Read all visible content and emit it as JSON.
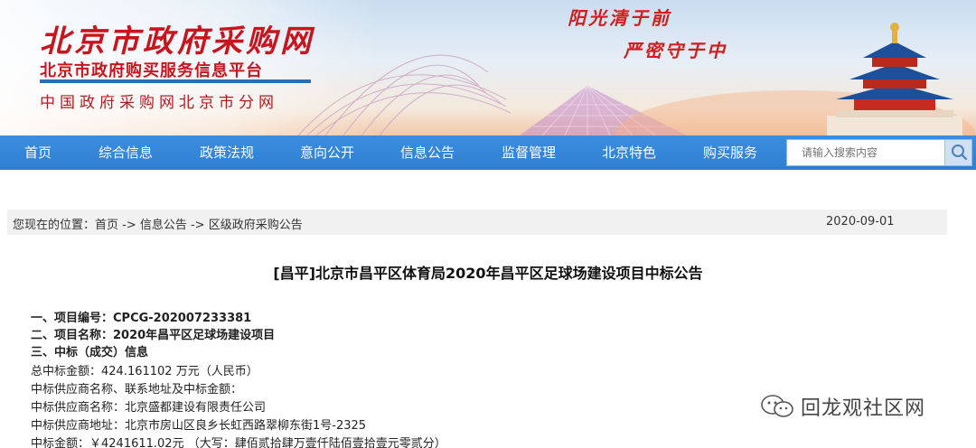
{
  "header": {
    "title": "北京市政府采购网",
    "subtitle": "北京市政府购买服务信息平台",
    "subtitle2": "中国政府采购网北京市分网",
    "slogan1": "阳光清于前",
    "slogan2": "严密守于中"
  },
  "nav": {
    "items": [
      {
        "label": "首页"
      },
      {
        "label": "综合信息"
      },
      {
        "label": "政策法规"
      },
      {
        "label": "意向公开"
      },
      {
        "label": "信息公告"
      },
      {
        "label": "监督管理"
      },
      {
        "label": "北京特色"
      },
      {
        "label": "购买服务"
      }
    ],
    "search_placeholder": "请输入搜索内容"
  },
  "breadcrumb": {
    "text": "您现在的位置：首页 -> 信息公告 -> 区级政府采购公告",
    "date": "2020-09-01"
  },
  "article": {
    "title": "[昌平]北京市昌平区体育局2020年昌平区足球场建设项目中标公告",
    "lines": [
      "一、项目编号：CPCG-202007233381",
      "二、项目名称：2020年昌平区足球场建设项目",
      "三、中标（成交）信息",
      "总中标金额：424.161102 万元（人民币）",
      "中标供应商名称、联系地址及中标金额：",
      "中标供应商名称：北京盛都建设有限责任公司",
      "中标供应商地址：北京市房山区良乡长虹西路翠柳东街1号-2325",
      "中标金额：￥4241611.02元 （大写：肆佰贰拾肆万壹仟陆佰壹拾壹元零贰分）"
    ]
  },
  "watermark": {
    "text": "回龙观社区网",
    "icon": "wechat-icon"
  },
  "colors": {
    "nav_bg": "#2f7ed2",
    "title_red": "#c8141c",
    "crumb_bg": "#f1f1f1"
  }
}
